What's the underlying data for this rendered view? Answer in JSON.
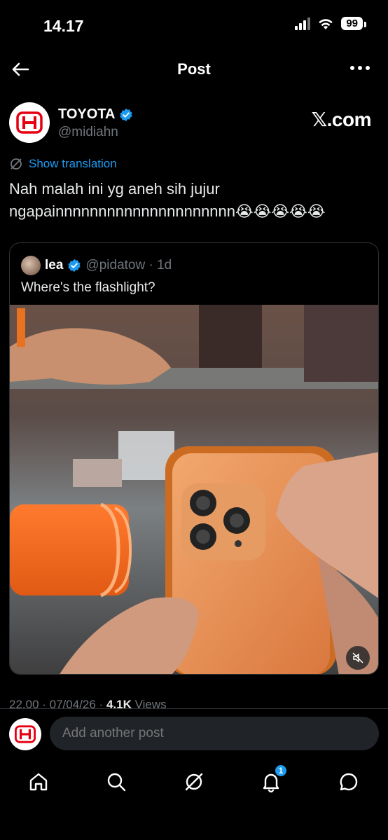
{
  "status_bar": {
    "time": "14.17",
    "battery": "99"
  },
  "header": {
    "title": "Post"
  },
  "post": {
    "author_name": "TOYOTA",
    "handle": "@midiahn",
    "source": "𝕏.com",
    "translation_label": "Show translation",
    "text": "Nah malah ini yg aneh sih jujur ngapainnnnnnnnnnnnnnnnnnnnn😭😭😭😭😭",
    "timestamp": "22.00 · 07/04/26 · ",
    "views_count": "4.1K",
    "views_label": " Views"
  },
  "quote": {
    "author_name": "lea",
    "handle_time": "@pidatow · 1d",
    "text": "Where's the flashlight?"
  },
  "reply": {
    "placeholder": "Add another post"
  },
  "nav": {
    "notification_count": "1"
  },
  "colors": {
    "accent": "#1d9bf0",
    "background": "#000000",
    "avatar_logo": "#e60012"
  }
}
